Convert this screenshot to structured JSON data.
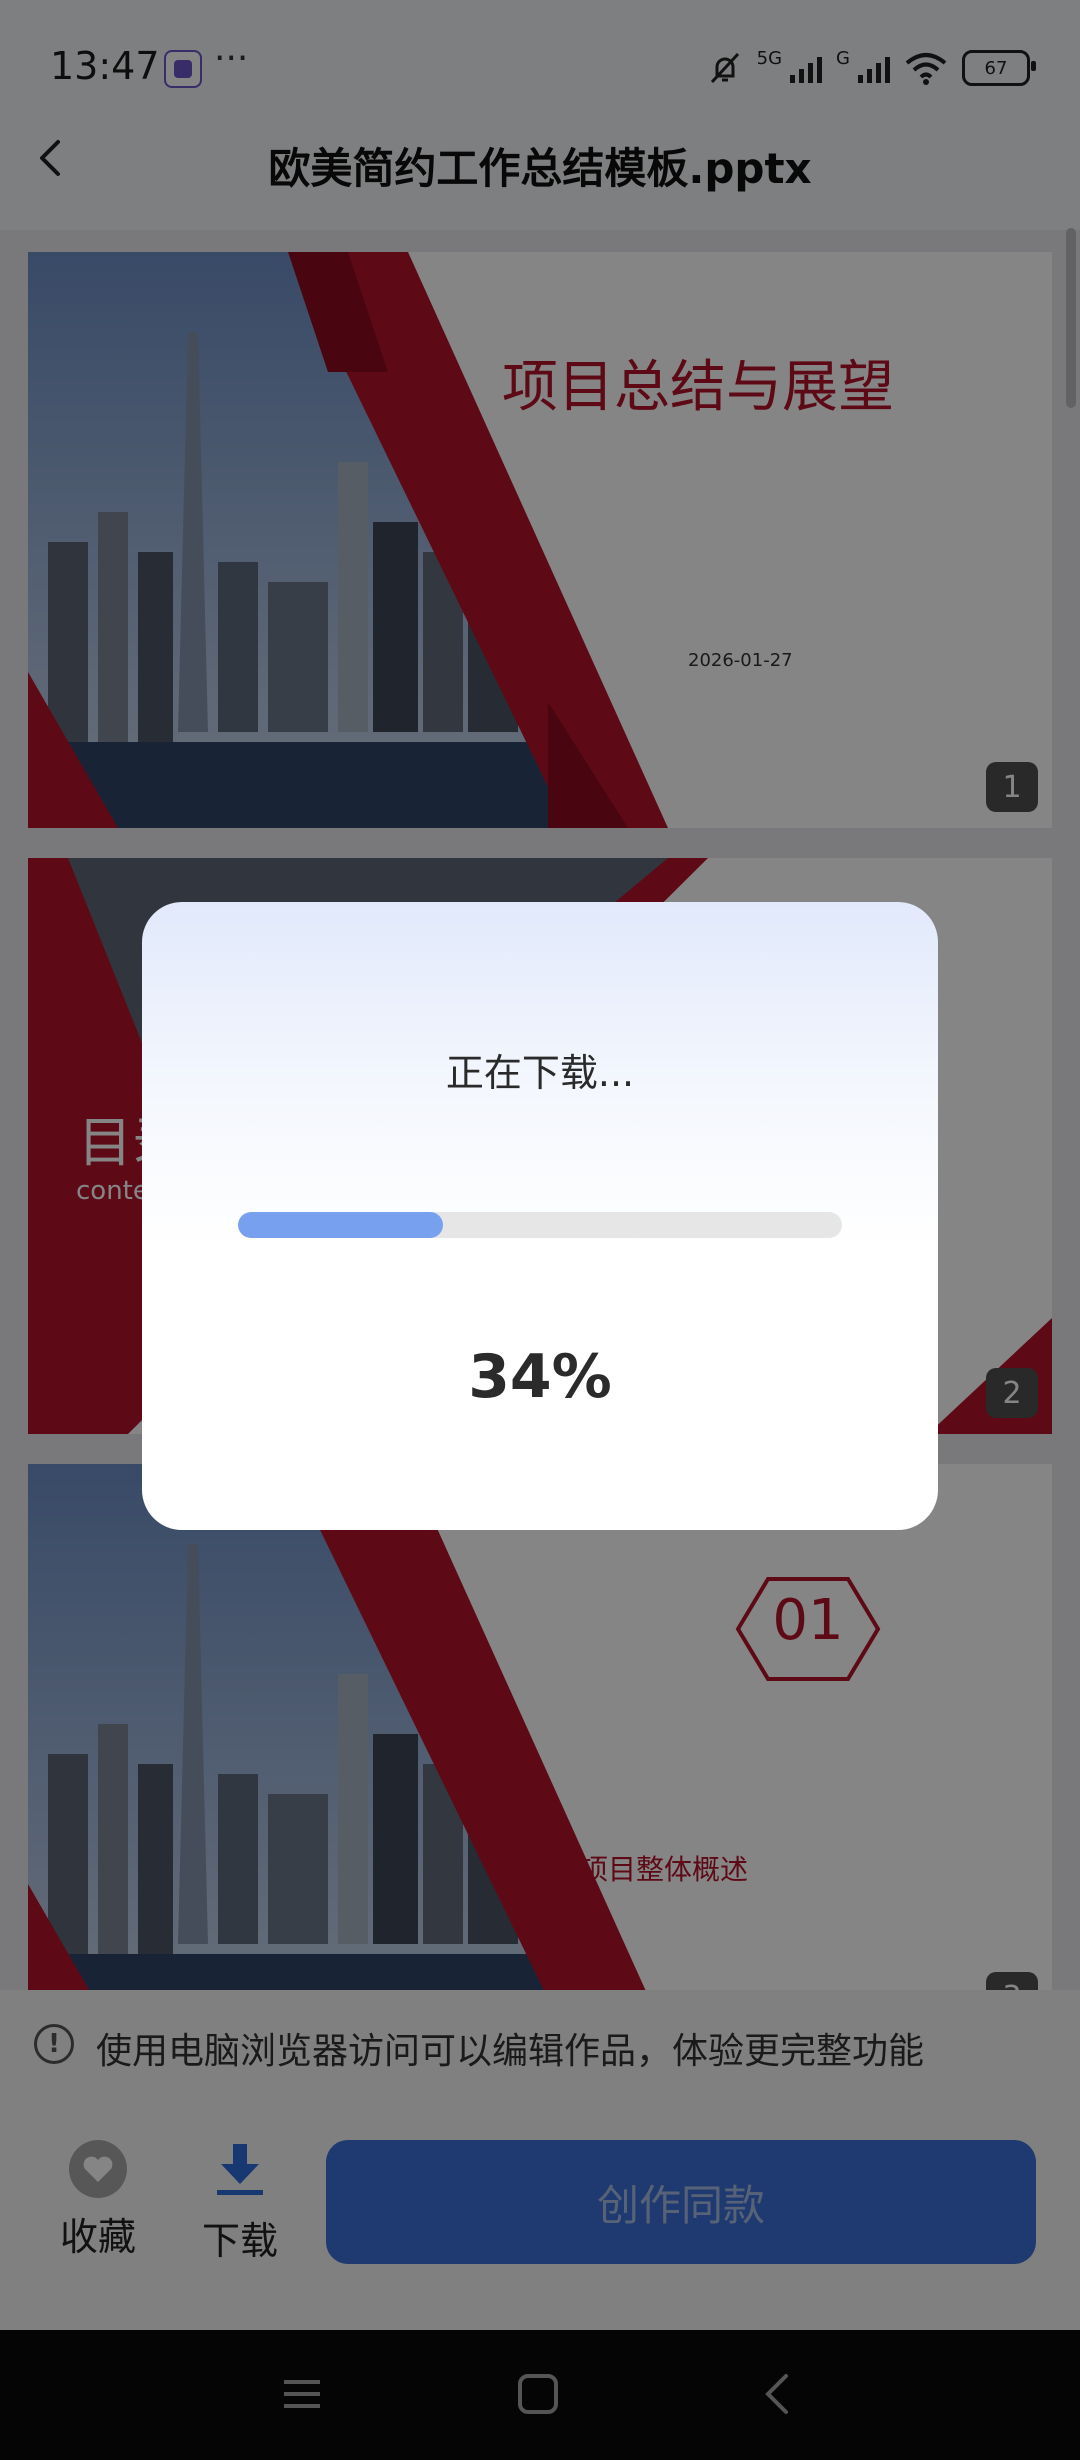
{
  "status_bar": {
    "time": "13:47",
    "more": "···",
    "signal1_label": "5G",
    "signal2_label": "G",
    "battery": "67",
    "icons": [
      "app-badge-icon",
      "mute-bell-icon",
      "signal-icon",
      "wifi-icon",
      "battery-icon"
    ]
  },
  "header": {
    "title": "欧美简约工作总结模板.pptx"
  },
  "slides": [
    {
      "page": "1",
      "heading": "项目总结与展望",
      "date": "2026-01-27"
    },
    {
      "page": "2",
      "heading_partial": "目录",
      "sub_partial": "contents"
    },
    {
      "page": "3",
      "number": "01",
      "caption": "项目整体概述"
    }
  ],
  "dialog": {
    "title": "正在下载...",
    "progress": 0.34,
    "percent_text": "34%"
  },
  "notice": {
    "text": "使用电脑浏览器访问可以编辑作品，体验更完整功能",
    "icon": "info-icon"
  },
  "actions": {
    "favorite_label": "收藏",
    "download_label": "下载",
    "create_label": "创作同款"
  },
  "colors": {
    "accent": "#3b6fd6",
    "progress": "#77a1ee",
    "slide_red": "#b5122b"
  }
}
